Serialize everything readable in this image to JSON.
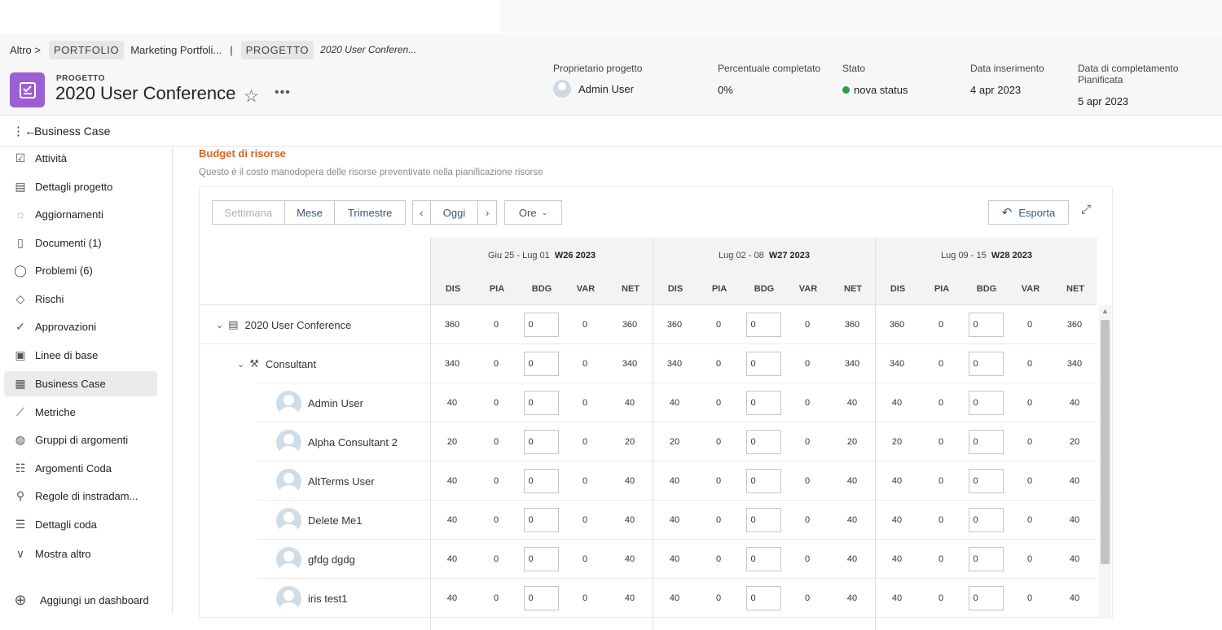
{
  "breadcrumb": {
    "other": "Altro >",
    "portfolio_chip": "PORTFOLIO",
    "portfolio_name": "Marketing Portfoli...",
    "separator": "|",
    "project_chip": "PROGETTO",
    "project_name": "2020 User Conferen..."
  },
  "project": {
    "label": "PROGETTO",
    "title": "2020 User Conference"
  },
  "meta": {
    "owner_label": "Proprietario progetto",
    "owner_value": "Admin User",
    "percent_label": "Percentuale completato",
    "percent_value": "0%",
    "status_label": "Stato",
    "status_value": "nova status",
    "status_color": "#2d9d4a",
    "entry_label": "Data inserimento",
    "entry_value": "4 apr 2023",
    "planned_label": "Data di completamento Pianificata",
    "planned_value": "5 apr 2023"
  },
  "section_bar": {
    "title": "Business Case"
  },
  "sidebar": {
    "items": [
      {
        "label": "Attività",
        "icon": "checklist-icon"
      },
      {
        "label": "Dettagli progetto",
        "icon": "document-icon"
      },
      {
        "label": "Aggiornamenti",
        "icon": "chat-bubble-icon"
      },
      {
        "label": "Documenti (1)",
        "icon": "file-icon"
      },
      {
        "label": "Problemi (6)",
        "icon": "issue-bubble-icon"
      },
      {
        "label": "Rischi",
        "icon": "warning-diamond-icon"
      },
      {
        "label": "Approvazioni",
        "icon": "check-circle-icon"
      },
      {
        "label": "Linee di base",
        "icon": "baseline-icon"
      },
      {
        "label": "Business Case",
        "icon": "business-case-icon",
        "active": true
      },
      {
        "label": "Metriche",
        "icon": "chart-line-icon"
      },
      {
        "label": "Gruppi di argomenti",
        "icon": "topic-group-icon"
      },
      {
        "label": "Argomenti Coda",
        "icon": "queue-topic-icon"
      },
      {
        "label": "Regole di instradam...",
        "icon": "routing-icon"
      },
      {
        "label": "Dettagli coda",
        "icon": "queue-details-icon"
      },
      {
        "label": "Mostra altro",
        "icon": "chevron-down-icon"
      }
    ],
    "add_dashboard": "Aggiungi un dashboard"
  },
  "budget": {
    "title": "Budget di risorse",
    "description": "Questo è il costo manodopera delle risorse preventivate nella pianificazione risorse",
    "toolbar": {
      "week": "Settimana",
      "month": "Mese",
      "quarter": "Trimestre",
      "today": "Oggi",
      "unit": "Ore",
      "export": "Esporta"
    },
    "weeks": [
      {
        "range": "Giu 25 - Lug 01",
        "label": "W26 2023"
      },
      {
        "range": "Lug 02 - 08",
        "label": "W27 2023"
      },
      {
        "range": "Lug 09 - 15",
        "label": "W28 2023"
      }
    ],
    "columns": [
      "DIS",
      "PIA",
      "BDG",
      "VAR",
      "NET"
    ],
    "rows": [
      {
        "name": "2020 User Conference",
        "level": 0,
        "type": "project",
        "values": [
          "360",
          "0",
          "0",
          "0",
          "360"
        ]
      },
      {
        "name": "Consultant",
        "level": 1,
        "type": "role",
        "values": [
          "340",
          "0",
          "0",
          "0",
          "340"
        ]
      },
      {
        "name": "Admin User",
        "level": 2,
        "type": "user",
        "values": [
          "40",
          "0",
          "0",
          "0",
          "40"
        ]
      },
      {
        "name": "Alpha Consultant 2",
        "level": 2,
        "type": "user",
        "values": [
          "20",
          "0",
          "0",
          "0",
          "20"
        ]
      },
      {
        "name": "AltTerms User",
        "level": 2,
        "type": "user",
        "values": [
          "40",
          "0",
          "0",
          "0",
          "40"
        ]
      },
      {
        "name": "Delete Me1",
        "level": 2,
        "type": "user",
        "values": [
          "40",
          "0",
          "0",
          "0",
          "40"
        ]
      },
      {
        "name": "gfdg dgdg",
        "level": 2,
        "type": "user",
        "values": [
          "40",
          "0",
          "0",
          "0",
          "40"
        ]
      },
      {
        "name": "iris test1",
        "level": 2,
        "type": "user",
        "values": [
          "40",
          "0",
          "0",
          "0",
          "40"
        ]
      }
    ]
  }
}
